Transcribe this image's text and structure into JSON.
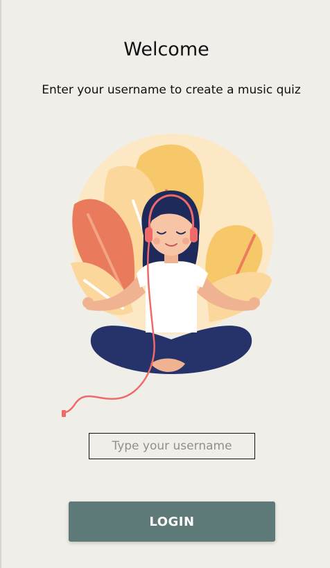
{
  "header": {
    "title": "Welcome",
    "subtitle": "Enter your username to create a music quiz"
  },
  "form": {
    "username_placeholder": "Type your username",
    "username_value": "",
    "login_label": "LOGIN"
  },
  "illustration": {
    "icon": "meditating-person-with-headphones-illustration"
  },
  "colors": {
    "background": "#f0eee8",
    "button": "#5d7a78",
    "sun": "#fde8c6",
    "leaf_coral": "#e97a5c",
    "leaf_yellow": "#f7c86a",
    "navy": "#26336b",
    "headphones": "#f06a6a"
  }
}
